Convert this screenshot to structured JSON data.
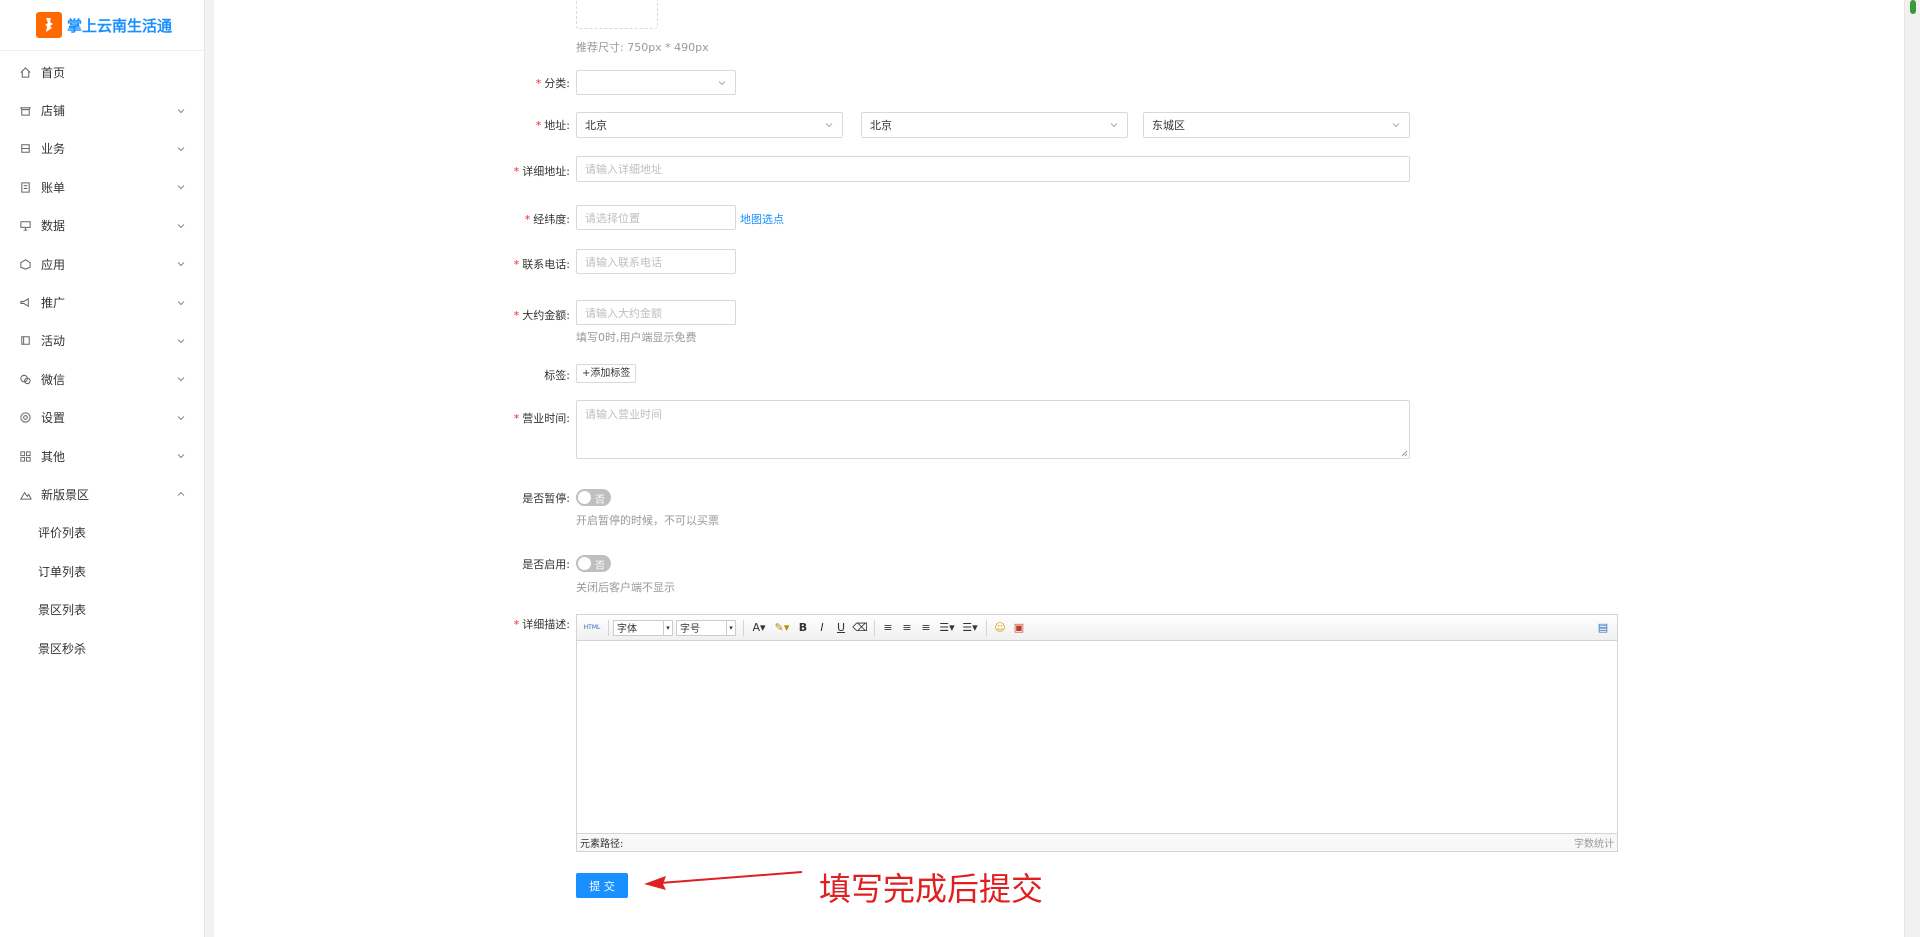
{
  "app": {
    "title": "掌上云南生活通",
    "brand_color": "#1890ff",
    "logo_color": "#ff6a00"
  },
  "sidebar": {
    "items": [
      {
        "label": "首页",
        "icon": "home-icon"
      },
      {
        "label": "店铺",
        "icon": "shop-icon"
      },
      {
        "label": "业务",
        "icon": "business-icon"
      },
      {
        "label": "账单",
        "icon": "bill-icon"
      },
      {
        "label": "数据",
        "icon": "data-icon"
      },
      {
        "label": "应用",
        "icon": "app-icon"
      },
      {
        "label": "推广",
        "icon": "promo-icon"
      },
      {
        "label": "活动",
        "icon": "activity-icon"
      },
      {
        "label": "微信",
        "icon": "wechat-icon"
      },
      {
        "label": "设置",
        "icon": "settings-icon"
      },
      {
        "label": "其他",
        "icon": "grid-icon"
      },
      {
        "label": "新版景区",
        "icon": "scenic-icon"
      }
    ],
    "subitems": [
      "评价列表",
      "订单列表",
      "景区列表",
      "景区秒杀"
    ]
  },
  "form": {
    "image_hint": "推荐尺寸: 750px * 490px",
    "category": {
      "label": "分类:",
      "value": ""
    },
    "address": {
      "label": "地址:",
      "province": "北京",
      "city": "北京",
      "district": "东城区"
    },
    "detail_address": {
      "label": "详细地址:",
      "placeholder": "请输入详细地址"
    },
    "latlng": {
      "label": "经纬度:",
      "placeholder": "请选择位置",
      "link": "地图选点"
    },
    "phone": {
      "label": "联系电话:",
      "placeholder": "请输入联系电话"
    },
    "price": {
      "label": "大约金额:",
      "placeholder": "请输入大约金额",
      "hint": "填写0时,用户端显示免费"
    },
    "tags": {
      "label": "标签:",
      "button": "+添加标签"
    },
    "hours": {
      "label": "营业时间:",
      "placeholder": "请输入营业时间"
    },
    "pause": {
      "label": "是否暂停:",
      "state": "否",
      "hint": "开启暂停的时候，不可以买票"
    },
    "enable": {
      "label": "是否启用:",
      "state": "否",
      "hint": "关闭后客户端不显示"
    },
    "description": {
      "label": "详细描述:"
    },
    "submit": "提 交"
  },
  "editor": {
    "html_btn": "HTML",
    "font_family": "字体",
    "font_size": "字号",
    "footer_left": "元素路径:",
    "footer_right": "字数统计"
  },
  "annotation": "填写完成后提交"
}
